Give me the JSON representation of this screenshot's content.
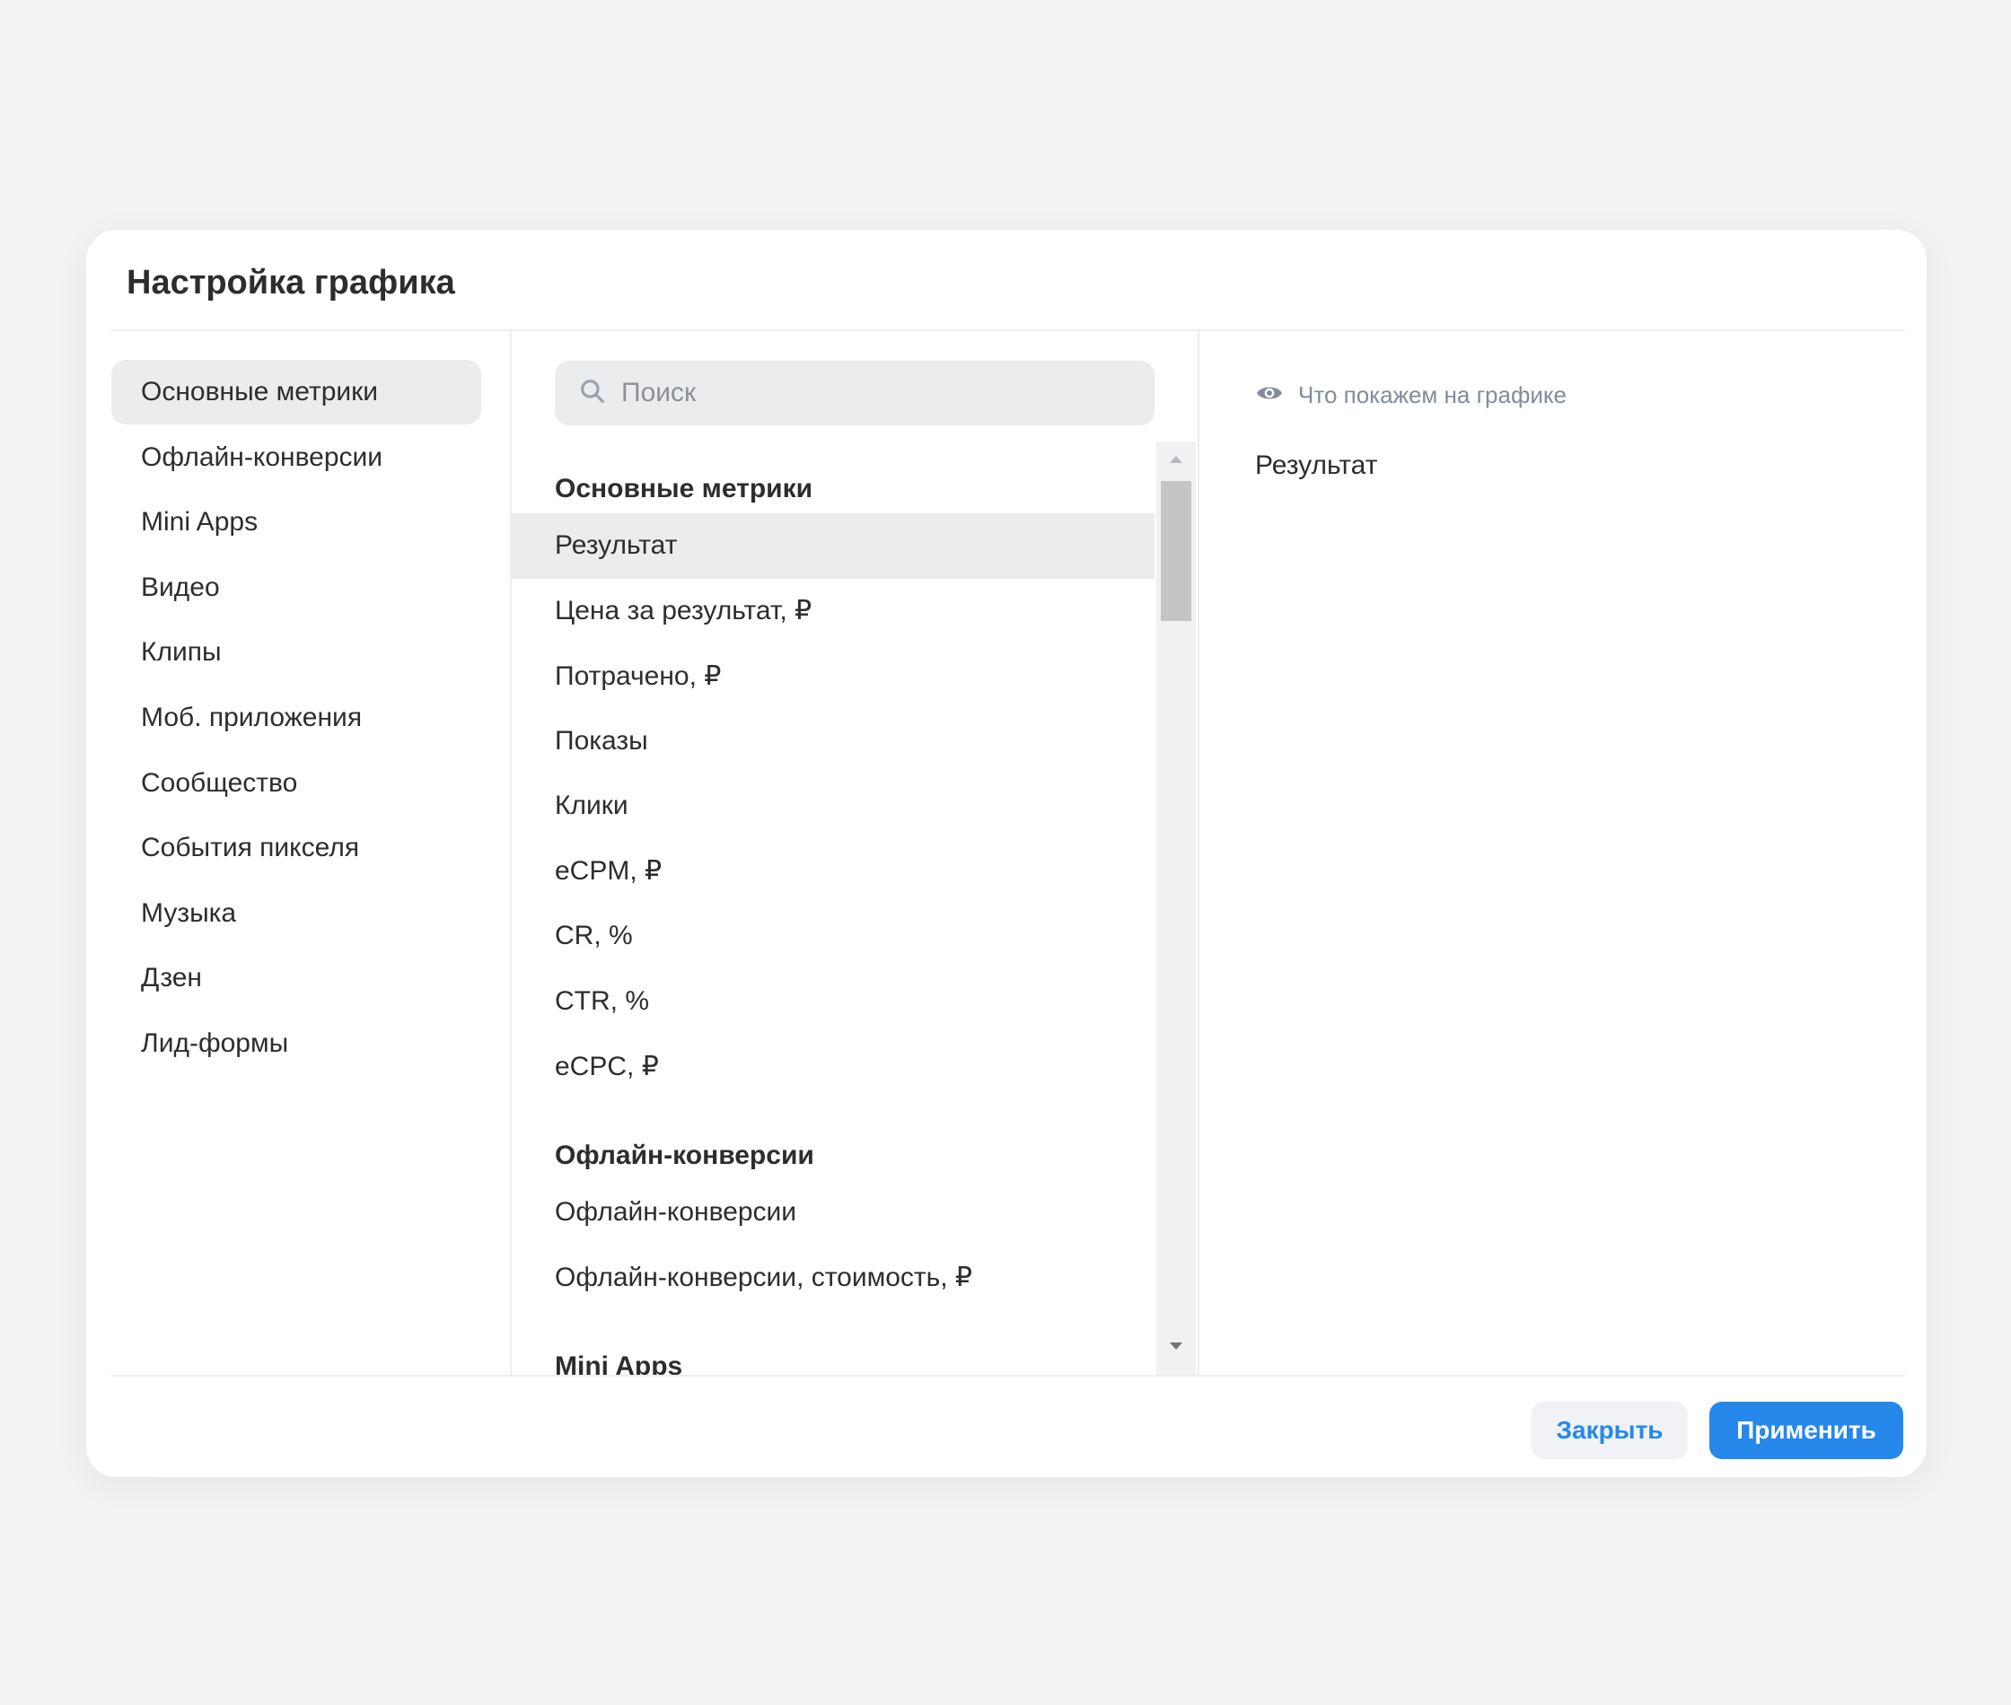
{
  "modal": {
    "title": "Настройка графика"
  },
  "nav": {
    "items": [
      {
        "label": "Основные метрики",
        "active": true
      },
      {
        "label": "Офлайн-конверсии"
      },
      {
        "label": "Mini Apps"
      },
      {
        "label": "Видео"
      },
      {
        "label": "Клипы"
      },
      {
        "label": "Моб. приложения"
      },
      {
        "label": "Сообщество"
      },
      {
        "label": "События пикселя"
      },
      {
        "label": "Музыка"
      },
      {
        "label": "Дзен"
      },
      {
        "label": "Лид-формы"
      }
    ]
  },
  "search": {
    "placeholder": "Поиск",
    "value": ""
  },
  "metrics": {
    "groups": [
      {
        "title": "Основные метрики",
        "items": [
          "Результат",
          "Цена за результат, ₽",
          "Потрачено, ₽",
          "Показы",
          "Клики",
          "eCPM, ₽",
          "CR, %",
          "CTR, %",
          "eCPC, ₽"
        ],
        "selected": "Результат"
      },
      {
        "title": "Офлайн-конверсии",
        "items": [
          "Офлайн-конверсии",
          "Офлайн-конверсии, стоимость, ₽"
        ]
      },
      {
        "title": "Mini Apps",
        "items": []
      }
    ]
  },
  "preview": {
    "label": "Что покажем на графике",
    "value": "Результат"
  },
  "footer": {
    "close_label": "Закрыть",
    "apply_label": "Применить"
  },
  "colors": {
    "accent": "#2688eb",
    "selected_bg": "#ebecee",
    "page_bg": "#f1f2f4"
  },
  "icons": {
    "search": "search-icon",
    "eye": "eye-icon",
    "scroll_up": "caret-up-icon",
    "scroll_down": "caret-down-icon"
  }
}
